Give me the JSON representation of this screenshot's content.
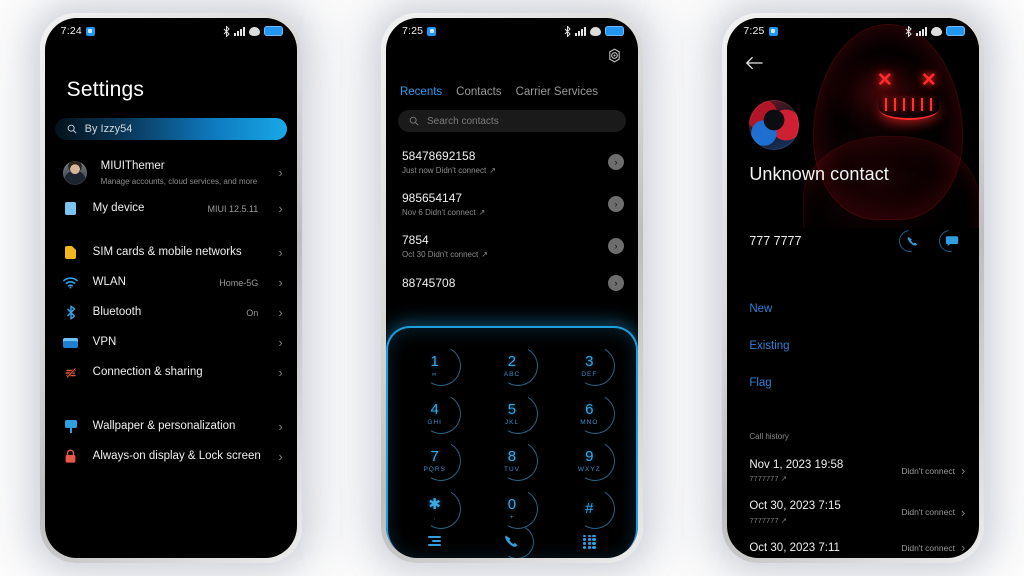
{
  "phone1": {
    "statusbar": {
      "time": "7:24",
      "badge_icon": "app-badge-icon",
      "icons": [
        "bluetooth-icon",
        "signal-icon",
        "wifi-icon",
        "battery-icon"
      ]
    },
    "title": "Settings",
    "search": {
      "value": "By Izzy54",
      "icon": "search-icon"
    },
    "items": [
      {
        "label": "MIUIThemer",
        "sub": "Manage accounts, cloud services, and more",
        "value": "",
        "icon": "avatar",
        "gap_after": false
      },
      {
        "label": "My device",
        "sub": "",
        "value": "MIUI 12.5.11",
        "icon": "device-icon",
        "gap_after": true
      },
      {
        "label": "SIM cards & mobile networks",
        "sub": "",
        "value": "",
        "icon": "sim-icon",
        "gap_after": false
      },
      {
        "label": "WLAN",
        "sub": "",
        "value": "Home-5G",
        "icon": "wifi-icon",
        "gap_after": false
      },
      {
        "label": "Bluetooth",
        "sub": "",
        "value": "On",
        "icon": "bluetooth-icon",
        "gap_after": false
      },
      {
        "label": "VPN",
        "sub": "",
        "value": "",
        "icon": "vpn-icon",
        "gap_after": false
      },
      {
        "label": "Connection & sharing",
        "sub": "",
        "value": "",
        "icon": "connection-sharing-icon",
        "gap_after": true
      },
      {
        "label": "Wallpaper & personalization",
        "sub": "",
        "value": "",
        "icon": "wallpaper-icon",
        "gap_after": false
      },
      {
        "label": "Always-on display & Lock screen",
        "sub": "",
        "value": "",
        "icon": "lock-icon",
        "gap_after": false
      }
    ],
    "chevron": "›"
  },
  "phone2": {
    "statusbar": {
      "time": "7:25"
    },
    "gear_icon": "gear-icon",
    "tabs": [
      {
        "label": "Recents",
        "active": true
      },
      {
        "label": "Contacts",
        "active": false
      },
      {
        "label": "Carrier Services",
        "active": false
      }
    ],
    "search": {
      "placeholder": "Search contacts",
      "icon": "search-icon"
    },
    "calls": [
      {
        "number": "58478692158",
        "meta": "Just now Didn't connect",
        "arrow": "↗"
      },
      {
        "number": "985654147",
        "meta": "Nov 6 Didn't connect",
        "arrow": "↗"
      },
      {
        "number": "7854",
        "meta": "Oct 30 Didn't connect",
        "arrow": "↗"
      },
      {
        "number": "88745708",
        "meta": "",
        "arrow": ""
      }
    ],
    "row_chevron": "›",
    "dialpad": {
      "keys": [
        {
          "digit": "1",
          "letters": "∞"
        },
        {
          "digit": "2",
          "letters": "ABC"
        },
        {
          "digit": "3",
          "letters": "DEF"
        },
        {
          "digit": "4",
          "letters": "GHI"
        },
        {
          "digit": "5",
          "letters": "JKL"
        },
        {
          "digit": "6",
          "letters": "MNO"
        },
        {
          "digit": "7",
          "letters": "PQRS"
        },
        {
          "digit": "8",
          "letters": "TUV"
        },
        {
          "digit": "9",
          "letters": "WXYZ"
        },
        {
          "digit": "✱",
          "letters": ","
        },
        {
          "digit": "0",
          "letters": "+"
        },
        {
          "digit": "#",
          "letters": ""
        }
      ],
      "actions": [
        {
          "icon": "call-log-list-icon"
        },
        {
          "icon": "call-icon"
        },
        {
          "icon": "keypad-icon"
        }
      ]
    },
    "accent": "#1f9ede"
  },
  "phone3": {
    "statusbar": {
      "time": "7:25"
    },
    "back_icon": "back-arrow-icon",
    "avatar_icon": "contact-avatar",
    "name": "Unknown contact",
    "number": "777 7777",
    "actions": [
      {
        "icon": "call-icon"
      },
      {
        "icon": "message-icon"
      }
    ],
    "links": [
      "New",
      "Existing",
      "Flag"
    ],
    "history_label": "Call history",
    "history": [
      {
        "date": "Nov 1, 2023 19:58",
        "sub": "7777777",
        "arrow": "↗",
        "state": "Didn't connect"
      },
      {
        "date": "Oct 30, 2023 7:15",
        "sub": "7777777",
        "arrow": "↗",
        "state": "Didn't connect"
      },
      {
        "date": "Oct 30, 2023 7:11",
        "sub": "",
        "arrow": "",
        "state": "Didn't connect"
      }
    ],
    "chevron": "›",
    "accent": "#2f9fe0",
    "hero_icon": "hooded-mask-figure"
  }
}
